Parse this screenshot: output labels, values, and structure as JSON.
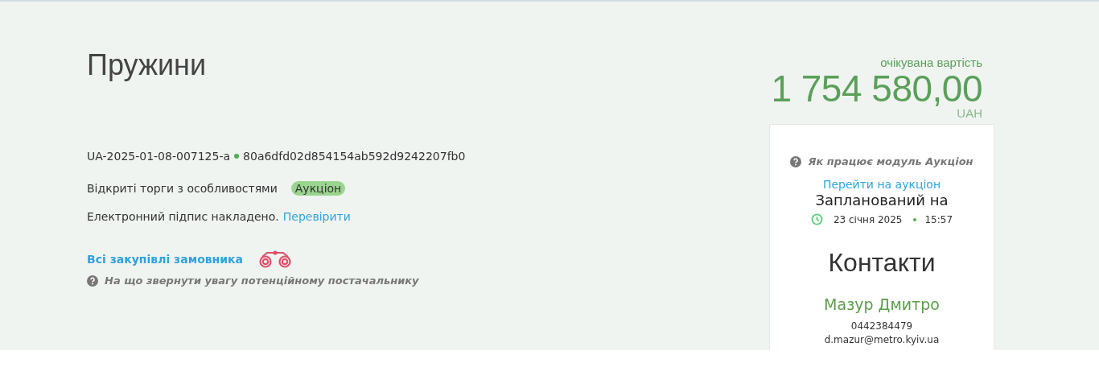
{
  "title": "Пружини",
  "expected_value": {
    "label": "очікувана вартість",
    "amount": "1 754 580,00",
    "currency": "UAH"
  },
  "tender": {
    "id": "UA-2025-01-08-007125-a",
    "hash": "80a6dfd02d854154ab592d9242207fb0"
  },
  "procedure": {
    "type": "Відкриті торги з особливостями",
    "badge": "Аукціон"
  },
  "signature": {
    "text": "Електронний підпис накладено.",
    "link": "Перевірити"
  },
  "buyer_link": "Всі закупівлі замовника",
  "hint": "На що звернути увагу потенційному постачальнику",
  "auction": {
    "help": "Як працює модуль Аукціон",
    "link": "Перейти на аукціон",
    "scheduled_label": "Запланований на",
    "date": "23 січня 2025",
    "time": "15:57"
  },
  "contacts": {
    "title": "Контакти",
    "name": "Мазур Дмитро",
    "phone": "0442384479",
    "email": "d.mazur@metro.kyiv.ua"
  }
}
